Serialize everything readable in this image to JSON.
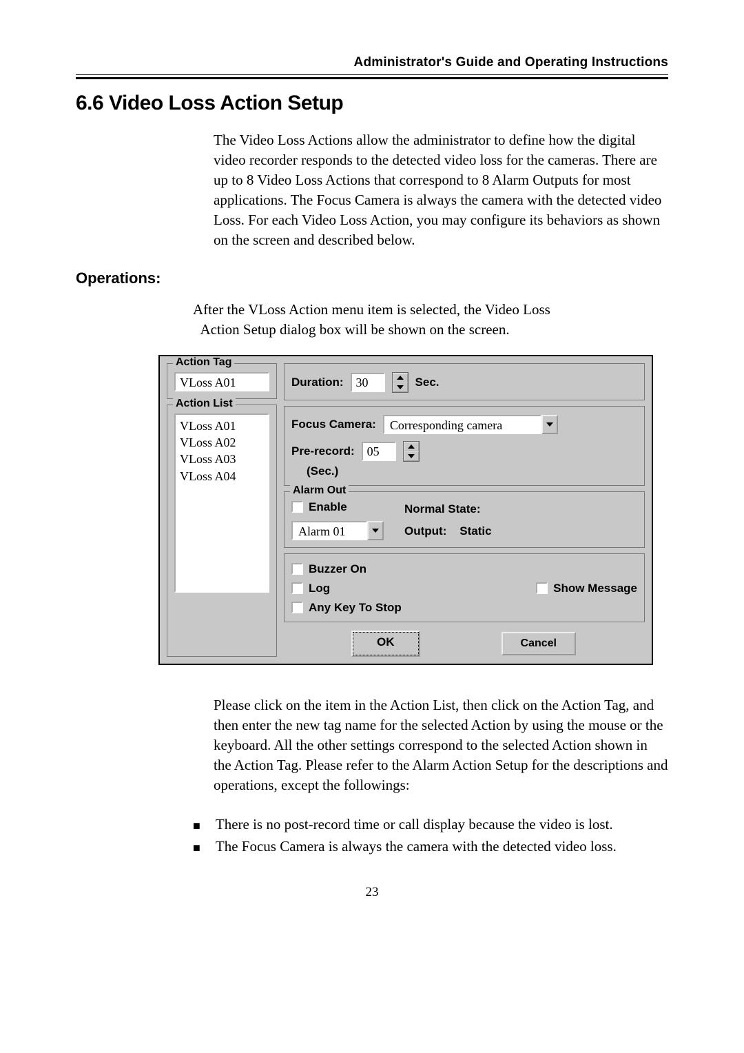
{
  "header": {
    "running": "Administrator's Guide and Operating Instructions"
  },
  "section": {
    "title": "6.6 Video Loss Action Setup"
  },
  "intro": "The Video Loss Actions allow the administrator to define how the digital video recorder responds to the detected video loss for the cameras.    There are up to 8 Video Loss Actions that correspond to 8 Alarm Outputs for most applications.    The Focus Camera is always the camera with the detected video Loss.    For each Video Loss Action, you may configure its behaviors as shown on the screen and described below.",
  "ops_heading": "Operations:",
  "ops_body_line1": "After the VLoss Action menu item is selected, the Video Loss",
  "ops_body_line2": "Action Setup dialog box will be shown on the screen.",
  "dialog": {
    "action_tag_label": "Action Tag",
    "action_tag_value": "VLoss A01",
    "action_list_label": "Action List",
    "action_list_items": [
      "VLoss A01",
      "VLoss A02",
      "VLoss A03",
      "VLoss A04"
    ],
    "duration_label": "Duration:",
    "duration_value": "30",
    "sec_label": "Sec.",
    "focus_camera_label": "Focus Camera:",
    "focus_camera_value": "Corresponding camera",
    "pre_record_label": "Pre-record:",
    "pre_record_value": "05",
    "pre_record_unit": "(Sec.)",
    "alarm_out_label": "Alarm Out",
    "enable_label": "Enable",
    "normal_state_label": "Normal State:",
    "alarm_combo_value": "Alarm 01",
    "output_label": "Output:",
    "output_value": "Static",
    "buzzer_label": "Buzzer On",
    "log_label": "Log",
    "show_message_label": "Show Message",
    "anykey_label": "Any Key To Stop",
    "ok_label": "OK",
    "cancel_label": "Cancel"
  },
  "after_dialog": "Please click on the item in the Action List, then click on the Action Tag, and then enter the new tag name for the selected Action by using the mouse or the keyboard.    All the other settings correspond to the selected Action shown in the Action Tag.    Please refer to the Alarm Action Setup for the descriptions and operations, except the followings:",
  "bullets": [
    "There is no post-record time or call display because the video is lost.",
    "The Focus Camera is always the camera with the detected video loss."
  ],
  "page_number": "23"
}
